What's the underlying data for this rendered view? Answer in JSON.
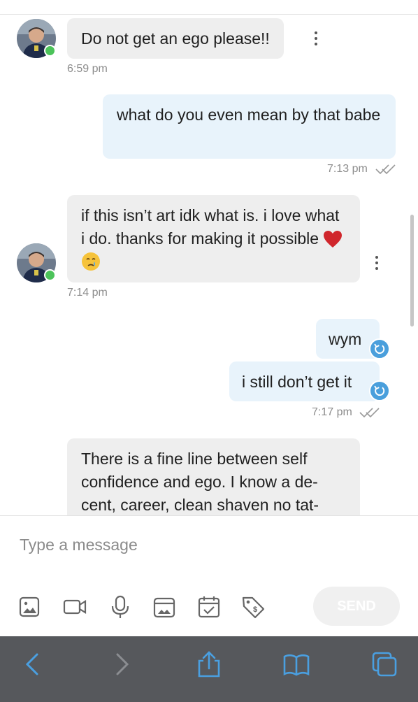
{
  "messages": [
    {
      "direction": "incoming",
      "text": "Do not get an ego please!!",
      "time": "6:59 pm"
    },
    {
      "direction": "outgoing",
      "text": "what do you even mean by that babe",
      "time": "7:13 pm",
      "status": "read"
    },
    {
      "direction": "incoming",
      "text": "if this isn’t art idk what is. i love what i do. thanks for making it possible",
      "emojis": [
        "red-heart",
        "crying-face"
      ],
      "time": "7:14 pm"
    },
    {
      "direction": "outgoing",
      "text": "wym",
      "status": "resend"
    },
    {
      "direction": "outgoing",
      "text": "i still don’t get it",
      "time": "7:17 pm",
      "status": "resend"
    },
    {
      "direction": "incoming",
      "text": "There is a fine line between self confidence and ego. I know a de-cent, career, clean shaven no tat-"
    }
  ],
  "composer": {
    "placeholder": "Type a message",
    "send_label": "SEND",
    "tools": [
      "image-icon",
      "video-icon",
      "microphone-icon",
      "gallery-icon",
      "calendar-icon",
      "tag-icon"
    ]
  },
  "browser_toolbar": {
    "icons": [
      "back-icon",
      "forward-icon",
      "share-icon",
      "bookmarks-icon",
      "tabs-icon"
    ]
  },
  "colors": {
    "incoming_bubble": "#eeeeee",
    "outgoing_bubble": "#e8f3fb",
    "online": "#4cc35a",
    "resend": "#4a9fdc",
    "toolbar_bg": "#56585c",
    "toolbar_icon": "#4a9fe0"
  }
}
